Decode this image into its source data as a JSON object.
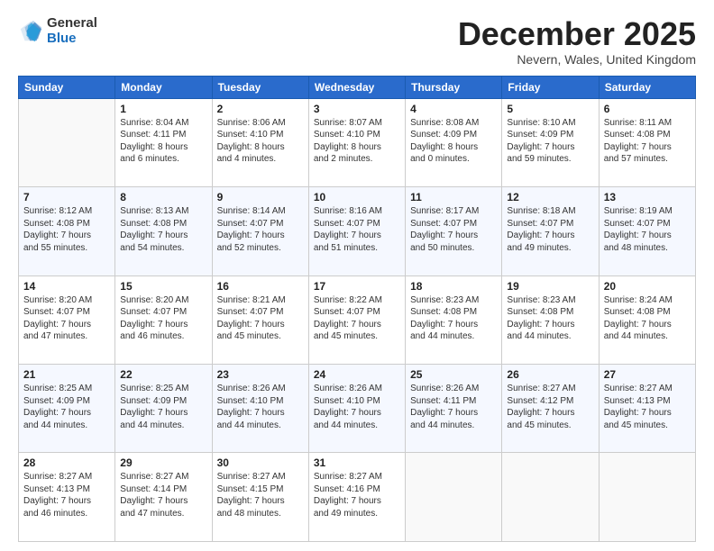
{
  "logo": {
    "general": "General",
    "blue": "Blue"
  },
  "title": "December 2025",
  "location": "Nevern, Wales, United Kingdom",
  "weekdays": [
    "Sunday",
    "Monday",
    "Tuesday",
    "Wednesday",
    "Thursday",
    "Friday",
    "Saturday"
  ],
  "weeks": [
    [
      {
        "day": "",
        "info": ""
      },
      {
        "day": "1",
        "info": "Sunrise: 8:04 AM\nSunset: 4:11 PM\nDaylight: 8 hours\nand 6 minutes."
      },
      {
        "day": "2",
        "info": "Sunrise: 8:06 AM\nSunset: 4:10 PM\nDaylight: 8 hours\nand 4 minutes."
      },
      {
        "day": "3",
        "info": "Sunrise: 8:07 AM\nSunset: 4:10 PM\nDaylight: 8 hours\nand 2 minutes."
      },
      {
        "day": "4",
        "info": "Sunrise: 8:08 AM\nSunset: 4:09 PM\nDaylight: 8 hours\nand 0 minutes."
      },
      {
        "day": "5",
        "info": "Sunrise: 8:10 AM\nSunset: 4:09 PM\nDaylight: 7 hours\nand 59 minutes."
      },
      {
        "day": "6",
        "info": "Sunrise: 8:11 AM\nSunset: 4:08 PM\nDaylight: 7 hours\nand 57 minutes."
      }
    ],
    [
      {
        "day": "7",
        "info": "Sunrise: 8:12 AM\nSunset: 4:08 PM\nDaylight: 7 hours\nand 55 minutes."
      },
      {
        "day": "8",
        "info": "Sunrise: 8:13 AM\nSunset: 4:08 PM\nDaylight: 7 hours\nand 54 minutes."
      },
      {
        "day": "9",
        "info": "Sunrise: 8:14 AM\nSunset: 4:07 PM\nDaylight: 7 hours\nand 52 minutes."
      },
      {
        "day": "10",
        "info": "Sunrise: 8:16 AM\nSunset: 4:07 PM\nDaylight: 7 hours\nand 51 minutes."
      },
      {
        "day": "11",
        "info": "Sunrise: 8:17 AM\nSunset: 4:07 PM\nDaylight: 7 hours\nand 50 minutes."
      },
      {
        "day": "12",
        "info": "Sunrise: 8:18 AM\nSunset: 4:07 PM\nDaylight: 7 hours\nand 49 minutes."
      },
      {
        "day": "13",
        "info": "Sunrise: 8:19 AM\nSunset: 4:07 PM\nDaylight: 7 hours\nand 48 minutes."
      }
    ],
    [
      {
        "day": "14",
        "info": "Sunrise: 8:20 AM\nSunset: 4:07 PM\nDaylight: 7 hours\nand 47 minutes."
      },
      {
        "day": "15",
        "info": "Sunrise: 8:20 AM\nSunset: 4:07 PM\nDaylight: 7 hours\nand 46 minutes."
      },
      {
        "day": "16",
        "info": "Sunrise: 8:21 AM\nSunset: 4:07 PM\nDaylight: 7 hours\nand 45 minutes."
      },
      {
        "day": "17",
        "info": "Sunrise: 8:22 AM\nSunset: 4:07 PM\nDaylight: 7 hours\nand 45 minutes."
      },
      {
        "day": "18",
        "info": "Sunrise: 8:23 AM\nSunset: 4:08 PM\nDaylight: 7 hours\nand 44 minutes."
      },
      {
        "day": "19",
        "info": "Sunrise: 8:23 AM\nSunset: 4:08 PM\nDaylight: 7 hours\nand 44 minutes."
      },
      {
        "day": "20",
        "info": "Sunrise: 8:24 AM\nSunset: 4:08 PM\nDaylight: 7 hours\nand 44 minutes."
      }
    ],
    [
      {
        "day": "21",
        "info": "Sunrise: 8:25 AM\nSunset: 4:09 PM\nDaylight: 7 hours\nand 44 minutes."
      },
      {
        "day": "22",
        "info": "Sunrise: 8:25 AM\nSunset: 4:09 PM\nDaylight: 7 hours\nand 44 minutes."
      },
      {
        "day": "23",
        "info": "Sunrise: 8:26 AM\nSunset: 4:10 PM\nDaylight: 7 hours\nand 44 minutes."
      },
      {
        "day": "24",
        "info": "Sunrise: 8:26 AM\nSunset: 4:10 PM\nDaylight: 7 hours\nand 44 minutes."
      },
      {
        "day": "25",
        "info": "Sunrise: 8:26 AM\nSunset: 4:11 PM\nDaylight: 7 hours\nand 44 minutes."
      },
      {
        "day": "26",
        "info": "Sunrise: 8:27 AM\nSunset: 4:12 PM\nDaylight: 7 hours\nand 45 minutes."
      },
      {
        "day": "27",
        "info": "Sunrise: 8:27 AM\nSunset: 4:13 PM\nDaylight: 7 hours\nand 45 minutes."
      }
    ],
    [
      {
        "day": "28",
        "info": "Sunrise: 8:27 AM\nSunset: 4:13 PM\nDaylight: 7 hours\nand 46 minutes."
      },
      {
        "day": "29",
        "info": "Sunrise: 8:27 AM\nSunset: 4:14 PM\nDaylight: 7 hours\nand 47 minutes."
      },
      {
        "day": "30",
        "info": "Sunrise: 8:27 AM\nSunset: 4:15 PM\nDaylight: 7 hours\nand 48 minutes."
      },
      {
        "day": "31",
        "info": "Sunrise: 8:27 AM\nSunset: 4:16 PM\nDaylight: 7 hours\nand 49 minutes."
      },
      {
        "day": "",
        "info": ""
      },
      {
        "day": "",
        "info": ""
      },
      {
        "day": "",
        "info": ""
      }
    ]
  ]
}
